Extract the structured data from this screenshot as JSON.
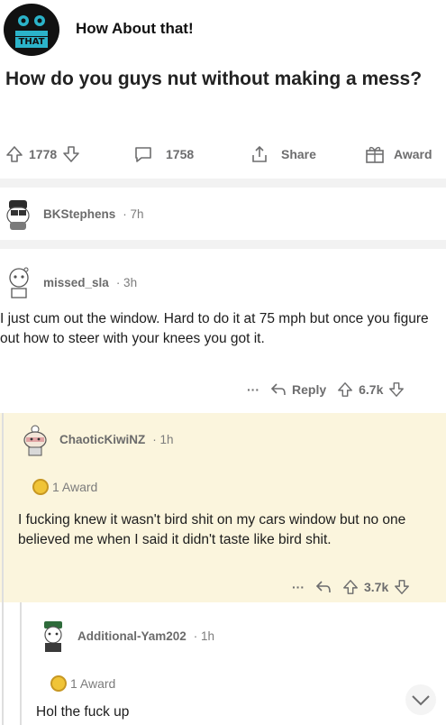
{
  "channel": {
    "name": "How About that!",
    "logo_text": "THAT"
  },
  "post": {
    "title": "How do you guys nut without making a mess?",
    "votes": "1778",
    "comments": "1758",
    "share_label": "Share",
    "award_label": "Award"
  },
  "comments": [
    {
      "user": "BKStephens",
      "time": "· 7h"
    },
    {
      "user": "missed_sla",
      "time": "· 3h",
      "body": "I just cum out the window. Hard to do it at 75 mph but once you figure out how to steer with your knees you got it.",
      "more": "···",
      "reply_label": "Reply",
      "votes": "6.7k"
    },
    {
      "user": "ChaoticKiwiNZ",
      "time": "· 1h",
      "award": "1 Award",
      "body": "I fucking knew it wasn't bird shit on my cars window but no one believed me when I said it didn't taste like bird shit.",
      "more": "···",
      "votes": "3.7k"
    },
    {
      "user": "Additional-Yam202",
      "time": "· 1h",
      "award": "1 Award",
      "body": "Hol the fuck up"
    }
  ],
  "colors": {
    "highlight": "#fbf5dd",
    "award": "#f0c437",
    "muted": "#6d6d6e"
  }
}
